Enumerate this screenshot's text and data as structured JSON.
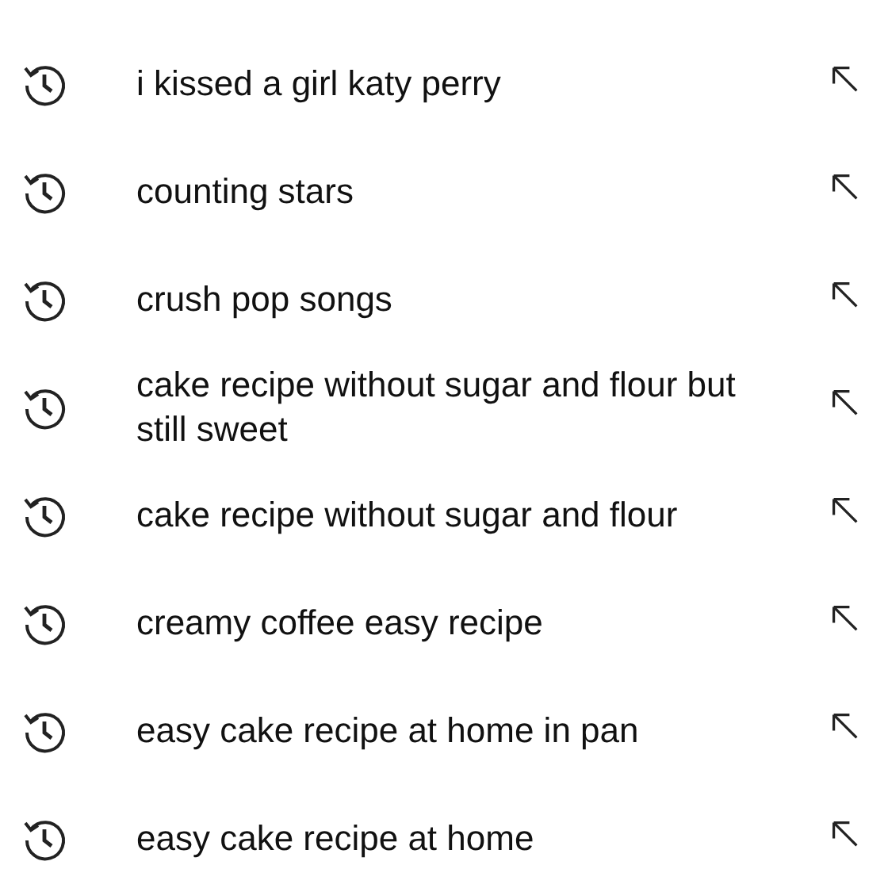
{
  "history": [
    {
      "query": "i kissed a girl katy perry"
    },
    {
      "query": "counting stars"
    },
    {
      "query": "crush pop songs"
    },
    {
      "query": "cake recipe without sugar and flour but still sweet"
    },
    {
      "query": "cake recipe without sugar and flour"
    },
    {
      "query": "creamy coffee easy recipe"
    },
    {
      "query": "easy cake recipe at home in pan"
    },
    {
      "query": "easy cake recipe at home"
    }
  ]
}
